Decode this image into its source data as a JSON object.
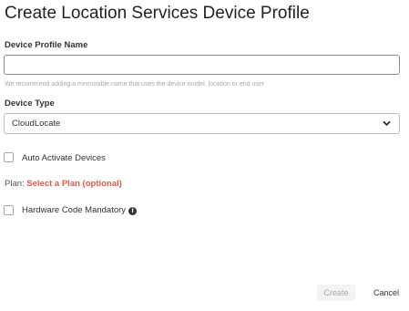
{
  "dialog": {
    "title": "Create Location Services Device Profile"
  },
  "form": {
    "profile_name": {
      "label": "Device Profile Name",
      "value": "",
      "hint": "We recommend adding a memorable name that uses the device model, location or end user"
    },
    "device_type": {
      "label": "Device Type",
      "selected": "CloudLocate"
    },
    "auto_activate": {
      "label": "Auto Activate Devices",
      "checked": false
    },
    "plan": {
      "label": "Plan: ",
      "link": "Select a Plan (optional)"
    },
    "hardware_code": {
      "label": "Hardware Code Mandatory",
      "checked": false,
      "info_icon": "info-icon"
    }
  },
  "actions": {
    "create": "Create",
    "cancel": "Cancel"
  },
  "colors": {
    "accent_link": "#e4594a",
    "disabled_text": "#a8a8a8"
  }
}
